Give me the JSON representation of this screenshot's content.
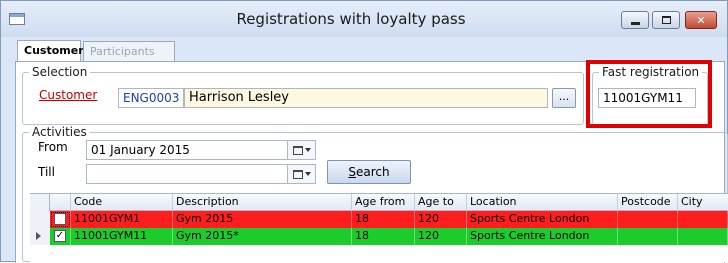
{
  "window": {
    "title": "Registrations with loyalty pass",
    "minimize_icon": "minimize-icon",
    "maximize_icon": "maximize-icon",
    "close_label": "✕"
  },
  "tabs": [
    {
      "label": "Customer",
      "active": true
    },
    {
      "label": "Participants",
      "active": false
    }
  ],
  "selection": {
    "legend": "Selection",
    "customer_label": "Customer",
    "customer_code": "ENG0003",
    "customer_name": "Harrison Lesley",
    "browse_label": "..."
  },
  "fast_registration": {
    "legend": "Fast registration",
    "value": "11001GYM11"
  },
  "activities": {
    "legend": "Activities",
    "from_label": "From",
    "from_value": "01 January 2015",
    "till_label": "Till",
    "till_value": "",
    "search_label": "Search",
    "columns": [
      "Code",
      "Description",
      "Age from",
      "Age to",
      "Location",
      "Postcode",
      "City"
    ],
    "rows": [
      {
        "checked": false,
        "code": "11001GYM1",
        "description": "Gym 2015",
        "age_from": "18",
        "age_to": "120",
        "location": "Sports Centre London",
        "postcode": "",
        "city": "",
        "color": "#ff1d1d"
      },
      {
        "checked": true,
        "code": "11001GYM11",
        "description": "Gym 2015*",
        "age_from": "18",
        "age_to": "120",
        "location": "Sports Centre London",
        "postcode": "",
        "city": "",
        "color": "#1ccc2c"
      }
    ]
  },
  "colors": {
    "highlight": "#e00000",
    "customer_link": "#c00000",
    "row_red": "#ff1d1d",
    "row_green": "#1ccc2c"
  }
}
